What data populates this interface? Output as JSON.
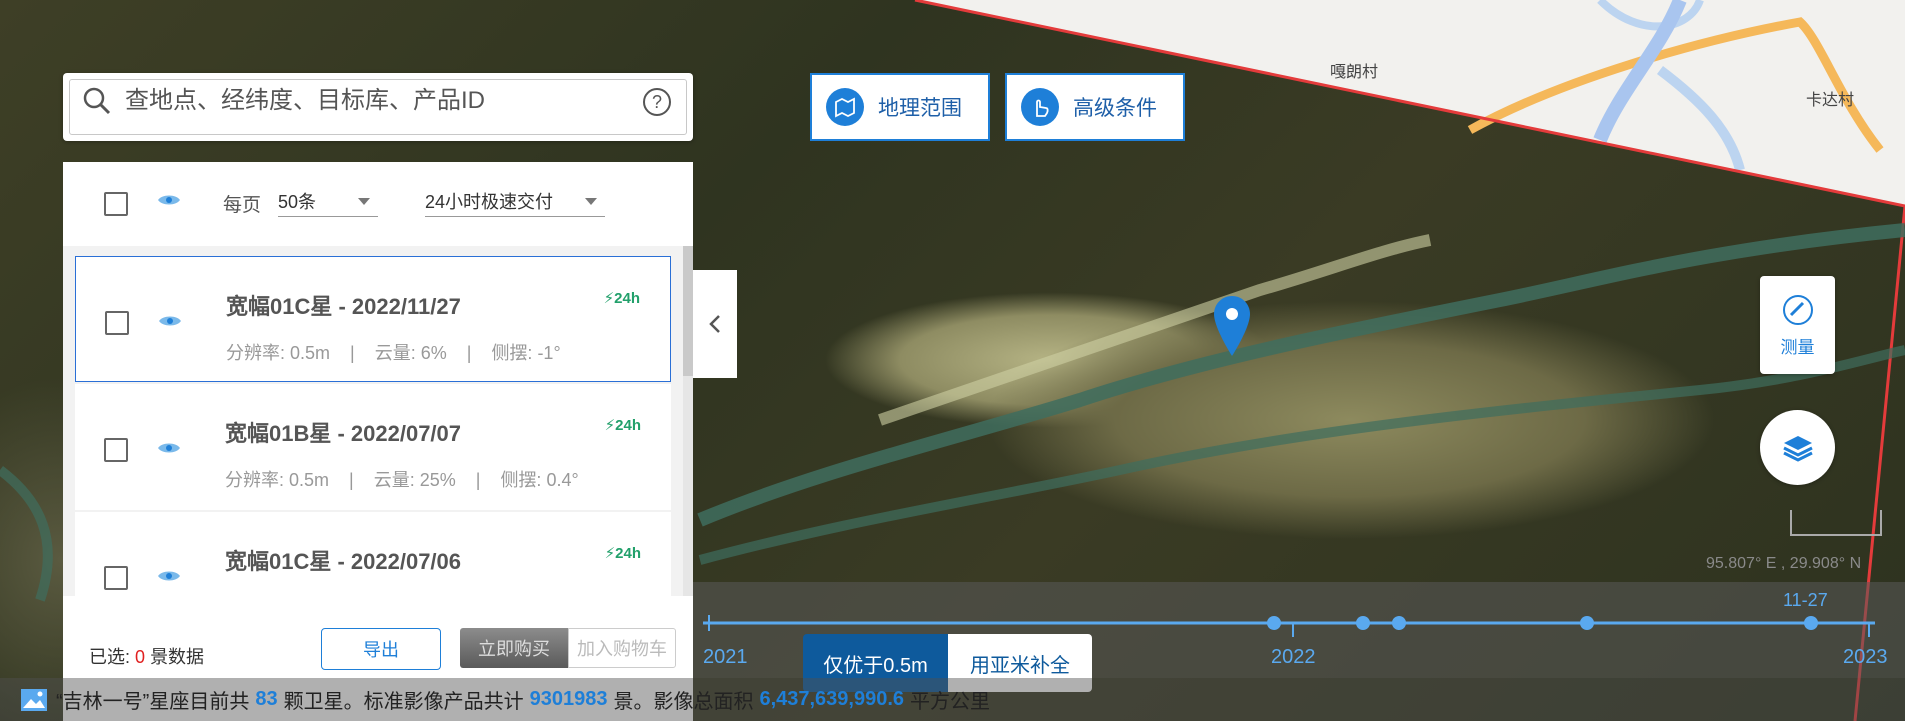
{
  "map": {
    "places": [
      "嘎朗村",
      "卡达村"
    ],
    "coords": "95.807° E , 29.908° N"
  },
  "search": {
    "placeholder": "查地点、经纬度、目标库、产品ID",
    "icon": "search-icon",
    "help_icon": "help-icon"
  },
  "top_buttons": [
    {
      "label": "地理范围",
      "icon": "map-area-icon"
    },
    {
      "label": "高级条件",
      "icon": "pointer-hand-icon"
    }
  ],
  "list_header": {
    "per_page_label": "每页",
    "per_page_value": "50条",
    "delivery_value": "24小时极速交付"
  },
  "results": [
    {
      "title": "宽幅01C星 - 2022/11/27",
      "resolution": "分辨率: 0.5m",
      "cloud": "云量: 6%",
      "tilt": "侧摆: -1°",
      "badge": "24h",
      "active": true
    },
    {
      "title": "宽幅01B星 - 2022/07/07",
      "resolution": "分辨率: 0.5m",
      "cloud": "云量: 25%",
      "tilt": "侧摆: 0.4°",
      "badge": "24h",
      "active": false
    },
    {
      "title": "宽幅01C星 - 2022/07/06",
      "resolution": "",
      "cloud": "",
      "tilt": "",
      "badge": "24h",
      "active": false
    }
  ],
  "footer": {
    "selected_prefix": "已选:",
    "selected_count": "0",
    "selected_suffix": "景数据",
    "export_label": "导出",
    "buy_label": "立即购买",
    "cart_label": "加入购物车"
  },
  "timeline": {
    "years": [
      "2021",
      "2022",
      "2023"
    ],
    "current_label": "11-27",
    "filter_on": "仅优于0.5m",
    "filter_off": "用亚米补全"
  },
  "right_tools": {
    "measure_label": "测量",
    "measure_icon": "ruler-icon",
    "layers_icon": "layers-icon"
  },
  "status": {
    "icon": "image-icon",
    "part1": "“吉林一号”星座目前共",
    "satellites": "83",
    "part2": "颗卫星。标准影像产品共计",
    "products": "9301983",
    "part3": "景。影像总面积",
    "area": "6,437,639,990.6",
    "part4": "平方公里"
  },
  "colors": {
    "accent": "#1e7fd8",
    "dark_accent": "#0e5a9c",
    "badge": "#22a06b",
    "count": "#e02020"
  }
}
